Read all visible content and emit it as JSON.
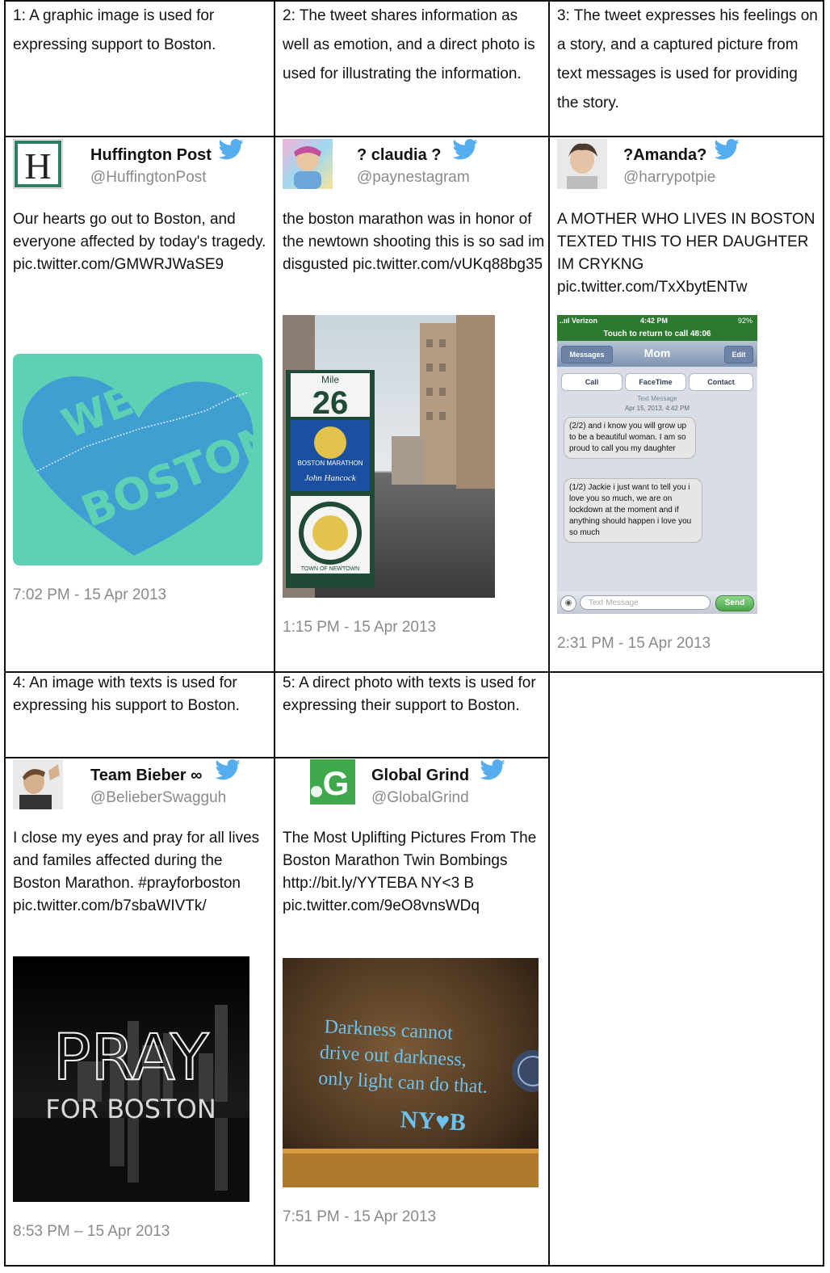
{
  "descriptions": {
    "d1": "1: A graphic image is used for expressing support to Boston.",
    "d2": "2: The tweet shares information as well as emotion, and a direct photo is used for illustrating the information.",
    "d3": "3: The tweet expresses his feelings on a story, and a captured picture from text messages is used for providing the story.",
    "d4": "4: An image with texts is used for expressing his support to Boston.",
    "d5": "5: A direct photo with texts is used for expressing their support to Boston."
  },
  "tweets": [
    {
      "name": "Huffington Post",
      "handle": "@HuffingtonPost",
      "text": "Our hearts go out to Boston, and everyone affected by today's tragedy. pic.twitter.com/GMWRJWaSE9",
      "time": "7:02 PM - 15 Apr 2013",
      "avatar_letter": "H",
      "image": {
        "line1": "WE",
        "line2": "BOSTON"
      }
    },
    {
      "name": "? claudia ?",
      "handle": "@paynestagram",
      "text": "the boston marathon was in honor of the newtown shooting this is so sad im disgusted pic.twitter.com/vUKq88bg35",
      "time": "1:15 PM - 15 Apr 2013",
      "image": {
        "mile_label": "Mile",
        "mile_number": "26",
        "banner_text": "BOSTON MARATHON",
        "sponsor": "John Hancock",
        "town_text": "TOWN OF NEWTOWN"
      }
    },
    {
      "name": "?Amanda?",
      "handle": "@harrypotpie",
      "text": "A MOTHER WHO LIVES IN BOSTON TEXTED THIS TO HER DAUGHTER IM CRYKNG pic.twitter.com/TxXbytENTw",
      "time": "2:31 PM - 15 Apr 2013",
      "phone": {
        "carrier": "..ııl Verizon",
        "clock": "4:42 PM",
        "battery": "92%",
        "call_banner": "Touch to return to call  48:06",
        "back_label": "Messages",
        "contact": "Mom",
        "edit_label": "Edit",
        "buttons": [
          "Call",
          "FaceTime",
          "Contact"
        ],
        "meta1": "Text Message",
        "meta2": "Apr 15, 2013, 4:42 PM",
        "bubble1": "(2/2) and i know you will grow up to be a beautiful woman. I am so proud to call you my daughter",
        "bubble2": "(1/2) Jackie i just want to tell you i love you so much, we are on lockdown at the moment and if anything should happen i love you so much",
        "input_placeholder": "Text Message",
        "send_label": "Send"
      }
    },
    {
      "name": "Team Bieber ∞",
      "handle": "@BelieberSwagguh",
      "text": "I close my eyes and pray for all lives and familes affected during the Boston Marathon. #prayforboston pic.twitter.com/b7sbaWIVTk/",
      "time": "8:53 PM – 15 Apr 2013",
      "image": {
        "line1": "PRAY",
        "line2": "FOR BOSTON"
      }
    },
    {
      "name": "Global Grind",
      "handle": "@GlobalGrind",
      "text": "The Most Uplifting Pictures From The Boston Marathon Twin Bombings http://bit.ly/YYTEBA NY<3 B pic.twitter.com/9eO8vnsWDq",
      "time": "7:51 PM - 15 Apr 2013",
      "avatar_letter": "G",
      "image": {
        "line1": "Darkness cannot",
        "line2": "drive out darkness,",
        "line3": "only light can do that.",
        "line4": "NY♥B"
      }
    }
  ],
  "colors": {
    "twitter_blue": "#55acee",
    "border": "#111111",
    "muted": "#8a8a8a",
    "heart_bg": "#5ed1b5",
    "heart": "#3f9fd1"
  }
}
